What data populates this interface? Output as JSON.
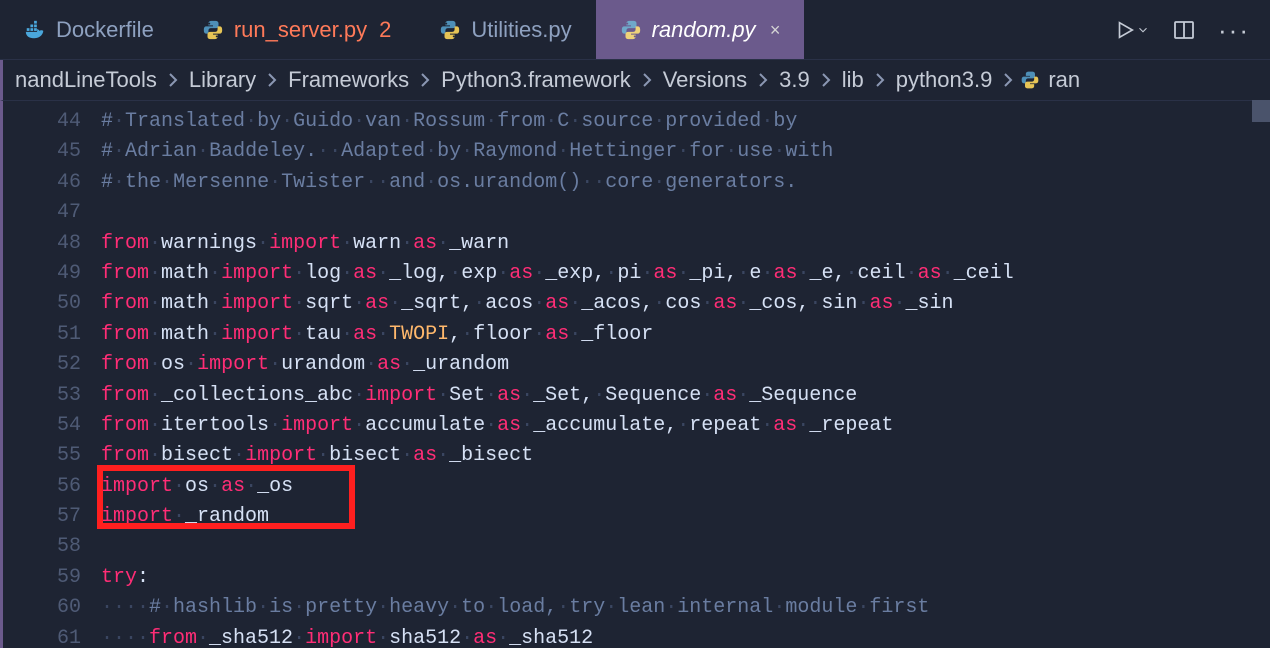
{
  "tabs": [
    {
      "label": "Dockerfile",
      "icon": "docker-icon",
      "modified": false,
      "active": false
    },
    {
      "label": "run_server.py",
      "icon": "python-icon",
      "modified": true,
      "mod_badge": "2",
      "active": false
    },
    {
      "label": "Utilities.py",
      "icon": "python-icon",
      "modified": false,
      "active": false
    },
    {
      "label": "random.py",
      "icon": "python-icon",
      "modified": false,
      "active": true,
      "close": "×"
    }
  ],
  "actions": {
    "run": "Run",
    "split": "Split editor",
    "more": "More actions"
  },
  "breadcrumb": {
    "segments": [
      "nandLineTools",
      "Library",
      "Frameworks",
      "Python3.framework",
      "Versions",
      "3.9",
      "lib",
      "python3.9"
    ],
    "file": "ran"
  },
  "gutter_start": 44,
  "lines": {
    "l44": {
      "cm": "# Translated by Guido van Rossum from C source provided by"
    },
    "l45": {
      "cm": "# Adrian Baddeley.  Adapted by Raymond Hettinger for use with"
    },
    "l46": {
      "cm": "# the Mersenne Twister  and os.urandom()  core generators."
    },
    "l47": {},
    "l48": {
      "from": "from",
      "m": "warnings",
      "import": "import",
      "rest": [
        [
          "warn",
          "as",
          "_warn"
        ]
      ]
    },
    "l49": {
      "from": "from",
      "m": "math",
      "import": "import",
      "rest": [
        [
          "log",
          "as",
          "_log"
        ],
        [
          "exp",
          "as",
          "_exp"
        ],
        [
          "pi",
          "as",
          "_pi"
        ],
        [
          "e",
          "as",
          "_e"
        ],
        [
          "ceil",
          "as",
          "_ceil"
        ]
      ]
    },
    "l50": {
      "from": "from",
      "m": "math",
      "import": "import",
      "rest": [
        [
          "sqrt",
          "as",
          "_sqrt"
        ],
        [
          "acos",
          "as",
          "_acos"
        ],
        [
          "cos",
          "as",
          "_cos"
        ],
        [
          "sin",
          "as",
          "_sin"
        ]
      ]
    },
    "l51": {
      "from": "from",
      "m": "math",
      "import": "import",
      "rest_special": {
        "a": "tau",
        "as": "as",
        "b": "TWOPI",
        "comma": ",",
        "c": "floor",
        "as2": "as",
        "d": "_floor"
      }
    },
    "l52": {
      "from": "from",
      "m": "os",
      "import": "import",
      "rest": [
        [
          "urandom",
          "as",
          "_urandom"
        ]
      ]
    },
    "l53": {
      "from": "from",
      "m": "_collections_abc",
      "import": "import",
      "rest": [
        [
          "Set",
          "as",
          "_Set"
        ],
        [
          "Sequence",
          "as",
          "_Sequence"
        ]
      ]
    },
    "l54": {
      "from": "from",
      "m": "itertools",
      "import": "import",
      "rest": [
        [
          "accumulate",
          "as",
          "_accumulate"
        ],
        [
          "repeat",
          "as",
          "_repeat"
        ]
      ]
    },
    "l55": {
      "from": "from",
      "m": "bisect",
      "import": "import",
      "rest": [
        [
          "bisect",
          "as",
          "_bisect"
        ]
      ]
    },
    "l56": {
      "import": "import",
      "m": "os",
      "as": "as",
      "alias": "_os"
    },
    "l57": {
      "import": "import",
      "m": "_random"
    },
    "l58": {},
    "l59": {
      "try": "try",
      ":": ":"
    },
    "l60": {
      "indent": "    ",
      "cm": "# hashlib is pretty heavy to load, try lean internal module first"
    },
    "l61": {
      "indent": "    ",
      "from": "from",
      "m": "_sha512",
      "import": "import",
      "rest": [
        [
          "sha512",
          "as",
          "_sha512"
        ]
      ]
    }
  },
  "icons": {
    "chevron": ">",
    "dots": "···"
  }
}
